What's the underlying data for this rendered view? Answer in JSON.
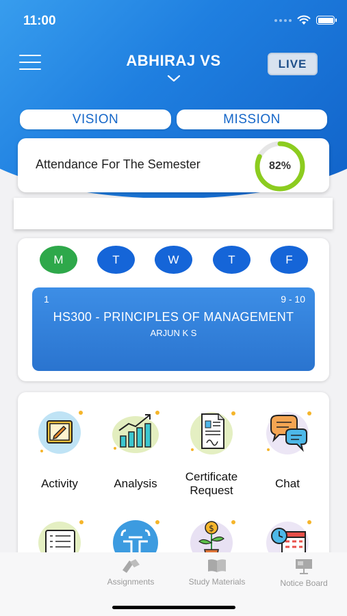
{
  "status_bar": {
    "time": "11:00"
  },
  "header": {
    "user_name": "ABHIRAJ VS",
    "live_label": "LIVE",
    "brand_color": "#1f7fe0"
  },
  "pills": {
    "vision": "VISION",
    "mission": "MISSION"
  },
  "attendance": {
    "label": "Attendance For The Semester",
    "percent_text": "82%",
    "percent": 82,
    "ring_color": "#8ccc1f"
  },
  "timetable": {
    "days": [
      {
        "label": "M",
        "active": true
      },
      {
        "label": "T",
        "active": false
      },
      {
        "label": "W",
        "active": false
      },
      {
        "label": "T",
        "active": false
      },
      {
        "label": "F",
        "active": false
      }
    ],
    "period": {
      "number": "1",
      "time": "9 - 10",
      "subject": "HS300 - PRINCIPLES OF MANAGEMENT",
      "teacher": "ARJUN K S"
    }
  },
  "menu": {
    "items": [
      {
        "label": "Activity",
        "icon": "pencil-note-icon"
      },
      {
        "label": "Analysis",
        "icon": "bar-chart-icon"
      },
      {
        "label": "Certificate\nRequest",
        "icon": "certificate-icon"
      },
      {
        "label": "Chat",
        "icon": "chat-bubbles-icon"
      },
      {
        "label": "",
        "icon": "checklist-icon"
      },
      {
        "label": "",
        "icon": "meeting-icon"
      },
      {
        "label": "",
        "icon": "money-plant-icon"
      },
      {
        "label": "",
        "icon": "calendar-clock-icon"
      }
    ]
  },
  "bottom_nav": {
    "items": [
      {
        "label": "Assignments",
        "icon": "assignment-icon"
      },
      {
        "label": "Study Materials",
        "icon": "book-icon"
      },
      {
        "label": "Notice Board",
        "icon": "notice-board-icon"
      }
    ]
  }
}
